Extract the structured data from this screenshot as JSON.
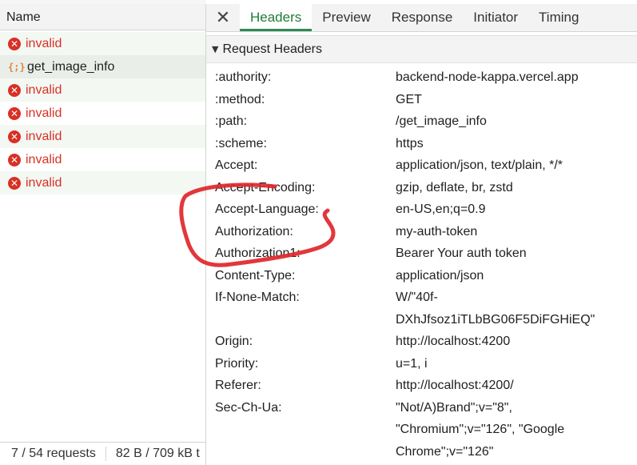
{
  "left": {
    "column_header": "Name",
    "requests": [
      {
        "label": "invalid",
        "status": "error"
      },
      {
        "label": "get_image_info",
        "status": "ok"
      },
      {
        "label": "invalid",
        "status": "error"
      },
      {
        "label": "invalid",
        "status": "error"
      },
      {
        "label": "invalid",
        "status": "error"
      },
      {
        "label": "invalid",
        "status": "error"
      },
      {
        "label": "invalid",
        "status": "error"
      }
    ],
    "status": {
      "requests": "7 / 54 requests",
      "transferred": "82 B / 709 kB t"
    }
  },
  "tabs": {
    "close": "✕",
    "items": [
      "Headers",
      "Preview",
      "Response",
      "Initiator",
      "Timing"
    ],
    "active": "Headers"
  },
  "section": {
    "title": "Request Headers",
    "toggle": "▼"
  },
  "headers": [
    {
      "name": ":authority:",
      "value": "backend-node-kappa.vercel.app"
    },
    {
      "name": ":method:",
      "value": "GET"
    },
    {
      "name": ":path:",
      "value": "/get_image_info"
    },
    {
      "name": ":scheme:",
      "value": "https"
    },
    {
      "name": "Accept:",
      "value": "application/json, text/plain, */*"
    },
    {
      "name": "Accept-Encoding:",
      "value": "gzip, deflate, br, zstd"
    },
    {
      "name": "Accept-Language:",
      "value": "en-US,en;q=0.9"
    },
    {
      "name": "Authorization:",
      "value": "my-auth-token"
    },
    {
      "name": "Authorization1:",
      "value": "Bearer Your auth token"
    },
    {
      "name": "Content-Type:",
      "value": "application/json"
    },
    {
      "name": "If-None-Match:",
      "value": "W/\"40f-DXhJfsoz1iTLbBG06F5DiFGHiEQ\""
    },
    {
      "name": "Origin:",
      "value": "http://localhost:4200"
    },
    {
      "name": "Priority:",
      "value": "u=1, i"
    },
    {
      "name": "Referer:",
      "value": "http://localhost:4200/"
    },
    {
      "name": "Sec-Ch-Ua:",
      "value": "\"Not/A)Brand\";v=\"8\", \"Chromium\";v=\"126\", \"Google Chrome\";v=\"126\""
    }
  ],
  "icons": {
    "error": "✕",
    "json": "{;}"
  },
  "colors": {
    "accent": "#1e7e34",
    "error": "#d93025",
    "json_icon": "#e0873b",
    "annotation": "#e0262b"
  }
}
